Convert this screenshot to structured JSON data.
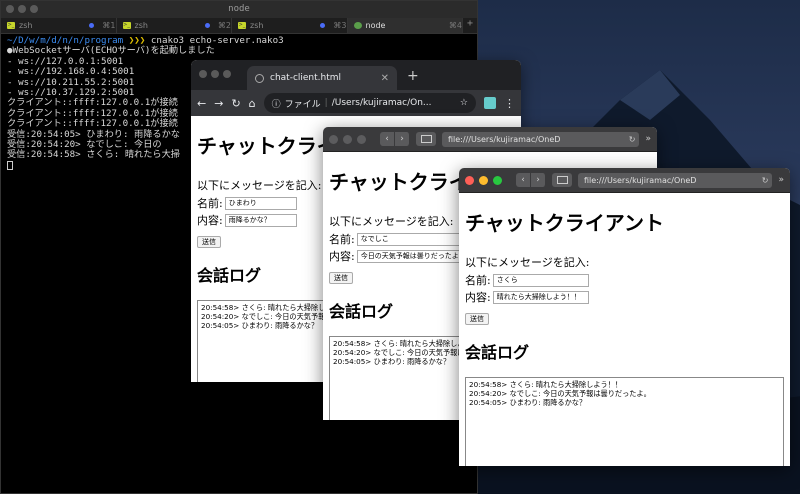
{
  "terminal": {
    "title": "node",
    "tabs": [
      {
        "label": "zsh",
        "key": "⌘1"
      },
      {
        "label": "zsh",
        "key": "⌘2"
      },
      {
        "label": "zsh",
        "key": "⌘3"
      },
      {
        "label": "node",
        "key": "⌘4"
      }
    ],
    "prompt_path": "~/D/w/m/d/n/n/program",
    "prompt_arrows": "❯❯❯",
    "command": "cnako3 echo-server.nako3",
    "lines": [
      "WebSocketサーバ(ECHOサーバ)を起動しました",
      "- ws://127.0.0.1:5001",
      "- ws://192.168.0.4:5001",
      "- ws://10.211.55.2:5001",
      "- ws://10.37.129.2:5001",
      "クライアント::ffff:127.0.0.1が接続",
      "クライアント::ffff:127.0.0.1が接続",
      "クライアント::ffff:127.0.0.1が接続",
      "受信:20:54:05> ひまわり: 雨降るかな",
      "受信:20:54:20> なでしこ: 今日の",
      "受信:20:54:58> さくら: 晴れたら大掃"
    ],
    "status_dot": "●"
  },
  "chrome": {
    "tab_title": "chat-client.html",
    "omnibox_scheme": "ファイル",
    "omnibox_path": "/Users/kujiramac/On...",
    "page": {
      "title": "チャットクライアント",
      "intro": "以下にメッセージを記入:",
      "name_label": "名前:",
      "name_value": "ひまわり",
      "content_label": "内容:",
      "content_value": "雨降るかな？",
      "send_label": "送信",
      "log_title": "会話ログ",
      "log": [
        "20:54:58> さくら: 晴れたら大掃除しよう！！",
        "20:54:20> なでしこ: 今日の天気予報は曇りだったよ。",
        "20:54:05> ひまわり: 雨降るかな？"
      ]
    }
  },
  "safari1": {
    "url": "file:///Users/kujiramac/OneD",
    "page": {
      "title": "チャットクライアント",
      "intro": "以下にメッセージを記入:",
      "name_label": "名前:",
      "name_value": "なでしこ",
      "content_label": "内容:",
      "content_value": "今日の天気予報は曇りだったよ。",
      "send_label": "送信",
      "log_title": "会話ログ",
      "log": [
        "20:54:58> さくら: 晴れたら大掃除しよう！！",
        "20:54:20> なでしこ: 今日の天気予報は曇りだったよ。",
        "20:54:05> ひまわり: 雨降るかな？"
      ]
    }
  },
  "safari2": {
    "url": "file:///Users/kujiramac/OneD",
    "page": {
      "title": "チャットクライアント",
      "intro": "以下にメッセージを記入:",
      "name_label": "名前:",
      "name_value": "さくら",
      "content_label": "内容:",
      "content_value": "晴れたら大掃除しよう！！",
      "send_label": "送信",
      "log_title": "会話ログ",
      "log": [
        "20:54:58> さくら: 晴れたら大掃除しよう！！",
        "20:54:20> なでしこ: 今日の天気予報は曇りだったよ。",
        "20:54:05> ひまわり: 雨降るかな？"
      ]
    }
  },
  "colors": {
    "prompt_path": "#3c8cf0",
    "prompt_arrows": "#e0c000",
    "close": "#fe5f57",
    "minimize": "#febc2e",
    "zoom": "#28c840"
  }
}
